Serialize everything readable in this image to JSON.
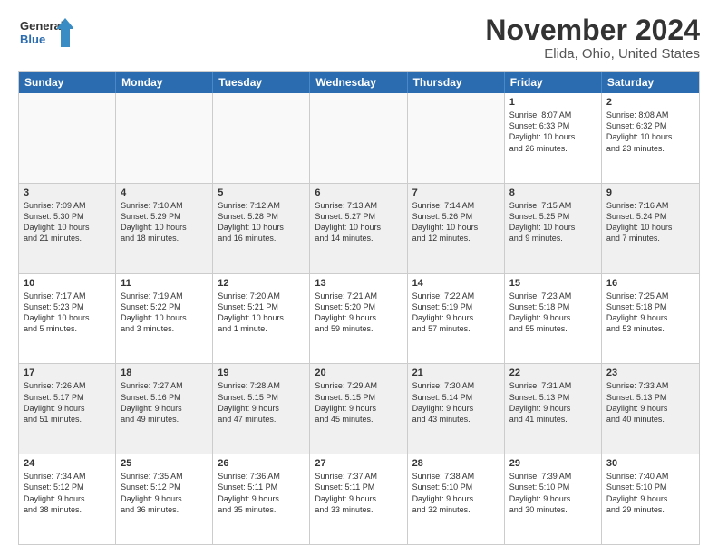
{
  "logo": {
    "line1": "General",
    "line2": "Blue"
  },
  "title": "November 2024",
  "location": "Elida, Ohio, United States",
  "weekdays": [
    "Sunday",
    "Monday",
    "Tuesday",
    "Wednesday",
    "Thursday",
    "Friday",
    "Saturday"
  ],
  "rows": [
    [
      {
        "day": "",
        "info": ""
      },
      {
        "day": "",
        "info": ""
      },
      {
        "day": "",
        "info": ""
      },
      {
        "day": "",
        "info": ""
      },
      {
        "day": "",
        "info": ""
      },
      {
        "day": "1",
        "info": "Sunrise: 8:07 AM\nSunset: 6:33 PM\nDaylight: 10 hours\nand 26 minutes."
      },
      {
        "day": "2",
        "info": "Sunrise: 8:08 AM\nSunset: 6:32 PM\nDaylight: 10 hours\nand 23 minutes."
      }
    ],
    [
      {
        "day": "3",
        "info": "Sunrise: 7:09 AM\nSunset: 5:30 PM\nDaylight: 10 hours\nand 21 minutes."
      },
      {
        "day": "4",
        "info": "Sunrise: 7:10 AM\nSunset: 5:29 PM\nDaylight: 10 hours\nand 18 minutes."
      },
      {
        "day": "5",
        "info": "Sunrise: 7:12 AM\nSunset: 5:28 PM\nDaylight: 10 hours\nand 16 minutes."
      },
      {
        "day": "6",
        "info": "Sunrise: 7:13 AM\nSunset: 5:27 PM\nDaylight: 10 hours\nand 14 minutes."
      },
      {
        "day": "7",
        "info": "Sunrise: 7:14 AM\nSunset: 5:26 PM\nDaylight: 10 hours\nand 12 minutes."
      },
      {
        "day": "8",
        "info": "Sunrise: 7:15 AM\nSunset: 5:25 PM\nDaylight: 10 hours\nand 9 minutes."
      },
      {
        "day": "9",
        "info": "Sunrise: 7:16 AM\nSunset: 5:24 PM\nDaylight: 10 hours\nand 7 minutes."
      }
    ],
    [
      {
        "day": "10",
        "info": "Sunrise: 7:17 AM\nSunset: 5:23 PM\nDaylight: 10 hours\nand 5 minutes."
      },
      {
        "day": "11",
        "info": "Sunrise: 7:19 AM\nSunset: 5:22 PM\nDaylight: 10 hours\nand 3 minutes."
      },
      {
        "day": "12",
        "info": "Sunrise: 7:20 AM\nSunset: 5:21 PM\nDaylight: 10 hours\nand 1 minute."
      },
      {
        "day": "13",
        "info": "Sunrise: 7:21 AM\nSunset: 5:20 PM\nDaylight: 9 hours\nand 59 minutes."
      },
      {
        "day": "14",
        "info": "Sunrise: 7:22 AM\nSunset: 5:19 PM\nDaylight: 9 hours\nand 57 minutes."
      },
      {
        "day": "15",
        "info": "Sunrise: 7:23 AM\nSunset: 5:18 PM\nDaylight: 9 hours\nand 55 minutes."
      },
      {
        "day": "16",
        "info": "Sunrise: 7:25 AM\nSunset: 5:18 PM\nDaylight: 9 hours\nand 53 minutes."
      }
    ],
    [
      {
        "day": "17",
        "info": "Sunrise: 7:26 AM\nSunset: 5:17 PM\nDaylight: 9 hours\nand 51 minutes."
      },
      {
        "day": "18",
        "info": "Sunrise: 7:27 AM\nSunset: 5:16 PM\nDaylight: 9 hours\nand 49 minutes."
      },
      {
        "day": "19",
        "info": "Sunrise: 7:28 AM\nSunset: 5:15 PM\nDaylight: 9 hours\nand 47 minutes."
      },
      {
        "day": "20",
        "info": "Sunrise: 7:29 AM\nSunset: 5:15 PM\nDaylight: 9 hours\nand 45 minutes."
      },
      {
        "day": "21",
        "info": "Sunrise: 7:30 AM\nSunset: 5:14 PM\nDaylight: 9 hours\nand 43 minutes."
      },
      {
        "day": "22",
        "info": "Sunrise: 7:31 AM\nSunset: 5:13 PM\nDaylight: 9 hours\nand 41 minutes."
      },
      {
        "day": "23",
        "info": "Sunrise: 7:33 AM\nSunset: 5:13 PM\nDaylight: 9 hours\nand 40 minutes."
      }
    ],
    [
      {
        "day": "24",
        "info": "Sunrise: 7:34 AM\nSunset: 5:12 PM\nDaylight: 9 hours\nand 38 minutes."
      },
      {
        "day": "25",
        "info": "Sunrise: 7:35 AM\nSunset: 5:12 PM\nDaylight: 9 hours\nand 36 minutes."
      },
      {
        "day": "26",
        "info": "Sunrise: 7:36 AM\nSunset: 5:11 PM\nDaylight: 9 hours\nand 35 minutes."
      },
      {
        "day": "27",
        "info": "Sunrise: 7:37 AM\nSunset: 5:11 PM\nDaylight: 9 hours\nand 33 minutes."
      },
      {
        "day": "28",
        "info": "Sunrise: 7:38 AM\nSunset: 5:10 PM\nDaylight: 9 hours\nand 32 minutes."
      },
      {
        "day": "29",
        "info": "Sunrise: 7:39 AM\nSunset: 5:10 PM\nDaylight: 9 hours\nand 30 minutes."
      },
      {
        "day": "30",
        "info": "Sunrise: 7:40 AM\nSunset: 5:10 PM\nDaylight: 9 hours\nand 29 minutes."
      }
    ]
  ]
}
